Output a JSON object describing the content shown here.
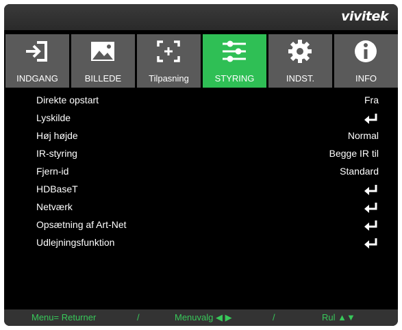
{
  "brand": "vivitek",
  "tabs": [
    {
      "label": "INDGANG",
      "icon": "input-icon"
    },
    {
      "label": "BILLEDE",
      "icon": "picture-icon"
    },
    {
      "label": "Tilpasning",
      "icon": "alignment-icon"
    },
    {
      "label": "STYRING",
      "icon": "sliders-icon",
      "active": true
    },
    {
      "label": "INDST.",
      "icon": "gear-icon"
    },
    {
      "label": "INFO",
      "icon": "info-icon"
    }
  ],
  "rows": [
    {
      "label": "Direkte opstart",
      "value": "Fra"
    },
    {
      "label": "Lyskilde",
      "value": null
    },
    {
      "label": "Høj højde",
      "value": "Normal"
    },
    {
      "label": "IR-styring",
      "value": "Begge IR til"
    },
    {
      "label": "Fjern-id",
      "value": "Standard"
    },
    {
      "label": "HDBaseT",
      "value": null
    },
    {
      "label": "Netværk",
      "value": null
    },
    {
      "label": "Opsætning af Art-Net",
      "value": null
    },
    {
      "label": "Udlejningsfunktion",
      "value": null
    }
  ],
  "footer": {
    "menu": "Menu= Returner",
    "sep": "/",
    "select": "Menuvalg ◀ ▶",
    "scroll": "Rul ▲▼"
  },
  "colors": {
    "active_tab": "#2fbf55",
    "tab": "#5a5a5a",
    "footer_text": "#38c85a",
    "background": "#000000"
  }
}
